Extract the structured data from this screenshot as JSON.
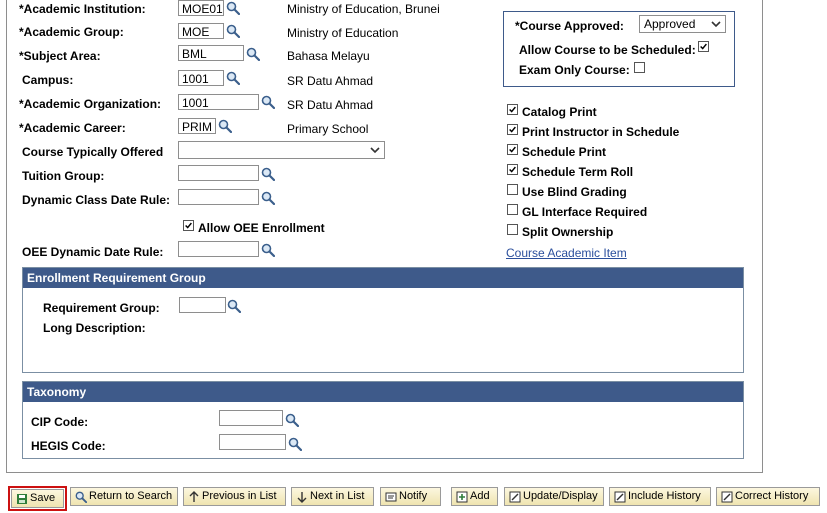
{
  "form": {
    "academic_institution": {
      "label": "*Academic Institution:",
      "value": "MOE01",
      "desc": "Ministry of Education, Brunei"
    },
    "academic_group": {
      "label": "*Academic Group:",
      "value": "MOE",
      "desc": "Ministry of Education"
    },
    "subject_area": {
      "label": "*Subject Area:",
      "value": "BML",
      "desc": "Bahasa Melayu"
    },
    "campus": {
      "label": "Campus:",
      "value": "1001",
      "desc": "SR Datu Ahmad"
    },
    "academic_organization": {
      "label": "*Academic Organization:",
      "value": "1001",
      "desc": "SR Datu Ahmad"
    },
    "academic_career": {
      "label": "*Academic Career:",
      "value": "PRIM",
      "desc": "Primary School"
    },
    "course_typically_offered": {
      "label": "Course Typically Offered",
      "value": ""
    },
    "tuition_group": {
      "label": "Tuition Group:",
      "value": ""
    },
    "dynamic_class_date_rule": {
      "label": "Dynamic Class Date Rule:",
      "value": ""
    },
    "allow_oee_enrollment": {
      "label": "Allow OEE Enrollment",
      "checked": true
    },
    "oee_dynamic_date_rule": {
      "label": "OEE Dynamic Date Rule:",
      "value": ""
    }
  },
  "approval": {
    "course_approved_label": "*Course Approved:",
    "course_approved_value": "Approved",
    "allow_scheduled_label": "Allow Course to be Scheduled:",
    "allow_scheduled_checked": true,
    "exam_only_label": "Exam Only Course:",
    "exam_only_checked": false
  },
  "options": [
    {
      "label": "Catalog Print",
      "checked": true
    },
    {
      "label": "Print Instructor in Schedule",
      "checked": true
    },
    {
      "label": "Schedule Print",
      "checked": true
    },
    {
      "label": "Schedule Term Roll",
      "checked": true
    },
    {
      "label": "Use Blind Grading",
      "checked": false
    },
    {
      "label": "GL Interface Required",
      "checked": false
    },
    {
      "label": "Split Ownership",
      "checked": false
    }
  ],
  "course_academic_item_link": "Course Academic Item",
  "enrollment_group": {
    "title": "Enrollment Requirement Group",
    "requirement_group_label": "Requirement Group:",
    "requirement_group_value": "",
    "long_description_label": "Long Description:"
  },
  "taxonomy": {
    "title": "Taxonomy",
    "cip_label": "CIP Code:",
    "cip_value": "",
    "hegis_label": "HEGIS Code:",
    "hegis_value": ""
  },
  "toolbar": {
    "save": "Save",
    "return_to_search": "Return to Search",
    "previous_in_list": "Previous in List",
    "next_in_list": "Next in List",
    "notify": "Notify",
    "add": "Add",
    "update_display": "Update/Display",
    "include_history": "Include History",
    "correct_history": "Correct History"
  },
  "colors": {
    "group_header": "#3e5a8a",
    "link": "#2b4f9c",
    "save_highlight": "#cc1111",
    "toolbar_bg": "#f5edc8"
  }
}
